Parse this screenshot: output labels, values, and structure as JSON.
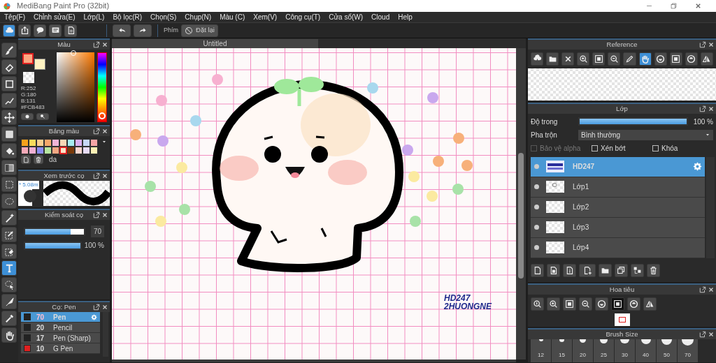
{
  "window": {
    "title": "MediBang Paint Pro (32bit)"
  },
  "menu": [
    "Tệp(F)",
    "Chỉnh sửa(E)",
    "Lớp(L)",
    "Bộ lọc(R)",
    "Chọn(S)",
    "Chụp(N)",
    "Màu (C)",
    "Xem(V)",
    "Công cụ(T)",
    "Cửa sổ(W)",
    "Cloud",
    "Help"
  ],
  "toolbar": {
    "icons": [
      {
        "kind": "cloud",
        "selected": true
      },
      {
        "kind": "share",
        "selected": false
      },
      {
        "kind": "chat",
        "selected": false
      },
      {
        "kind": "note",
        "selected": false
      },
      {
        "kind": "page",
        "selected": false
      }
    ],
    "key_label": "Phím",
    "reset": "Đặt lại"
  },
  "tools": [
    {
      "kind": "brush",
      "selected": false
    },
    {
      "kind": "eraser",
      "selected": false
    },
    {
      "kind": "square",
      "selected": false
    },
    {
      "kind": "polyline",
      "selected": false
    },
    {
      "kind": "move",
      "selected": false
    },
    {
      "kind": "filled-square",
      "selected": false
    },
    {
      "kind": "bucket",
      "selected": false
    },
    {
      "kind": "gradient",
      "selected": false
    },
    {
      "kind": "dashed-square",
      "selected": false
    },
    {
      "kind": "dashed-ellipse",
      "selected": false
    },
    {
      "kind": "wand",
      "selected": false
    },
    {
      "kind": "pencil-square",
      "selected": false
    },
    {
      "kind": "eraser-square",
      "selected": false
    },
    {
      "kind": "text",
      "selected": true
    },
    {
      "kind": "lasso",
      "selected": false
    },
    {
      "kind": "knife",
      "selected": false
    },
    {
      "kind": "eyedropper",
      "selected": false
    },
    {
      "kind": "hand",
      "selected": false
    }
  ],
  "color_panel": {
    "title": "Màu",
    "primary": {
      "color": "#fca882"
    },
    "secondary": {
      "color": "#fff3c2"
    },
    "hue": {
      "level": 0.03
    },
    "rgb": [
      "R:252",
      "G:180",
      "B:131"
    ],
    "hex": "#FCB483"
  },
  "palette": {
    "title": "Bảng màu",
    "name": "da",
    "swatches": [
      {
        "color": "#f7a21b",
        "selected": false
      },
      {
        "color": "#f9dc5c",
        "selected": false
      },
      {
        "color": "#f9cf8f",
        "selected": false
      },
      {
        "color": "#f4a86a",
        "selected": false
      },
      {
        "color": "#f2b4d6",
        "selected": false
      },
      {
        "color": "#fad7b6",
        "selected": false
      },
      {
        "color": "#a6ecef",
        "selected": false
      },
      {
        "color": "#d9b0ef",
        "selected": false
      },
      {
        "color": "#c6d8f7",
        "selected": false
      },
      {
        "color": "#f5a5a5",
        "selected": false
      },
      {
        "color": "#f4a9b8",
        "selected": false
      },
      {
        "color": "#f0b0d4",
        "selected": false
      },
      {
        "color": "#8a8cf0",
        "selected": false
      },
      {
        "color": "#b7e6a0",
        "selected": false
      },
      {
        "color": "#f3a783",
        "selected": false
      },
      {
        "color": "#fce4c7",
        "selected": true
      },
      {
        "color": "#7a3a0a",
        "selected": false
      },
      {
        "color": "#fcd7cf",
        "selected": false
      },
      {
        "color": "#e8dcf6",
        "selected": false
      },
      {
        "color": "#fdf0b4",
        "selected": false
      }
    ]
  },
  "brush_preview": {
    "title": "Xem trước cọ",
    "size": "* 5.08m"
  },
  "brush_control": {
    "title": "Kiểm soát cọ",
    "size": {
      "level": 0.78,
      "value": "70"
    },
    "opacity": {
      "level": 1,
      "reading": "100 %"
    }
  },
  "brushes": {
    "title": "Cọ: Pen",
    "items": [
      {
        "size": "70",
        "name": "Pen",
        "color": "#222222",
        "selected": true
      },
      {
        "size": "20",
        "name": "Pencil",
        "color": "#222222",
        "selected": false
      },
      {
        "size": "17",
        "name": "Pen (Sharp)",
        "color": "#222222",
        "selected": false
      },
      {
        "size": "10",
        "name": "G Pen",
        "color": "#e02020",
        "selected": false
      }
    ]
  },
  "canvas": {
    "tab": "Untitled",
    "signature": [
      "HD247",
      "2HUONGNE"
    ]
  },
  "reference": {
    "title": "Reference",
    "tools": [
      {
        "kind": "cloud-download",
        "selected": false
      },
      {
        "kind": "folder",
        "selected": false
      },
      {
        "kind": "close",
        "selected": false
      },
      {
        "kind": "zoom-in",
        "selected": false
      },
      {
        "kind": "fit",
        "selected": false
      },
      {
        "kind": "zoom-out",
        "selected": false
      },
      {
        "kind": "pen",
        "selected": false
      },
      {
        "kind": "hand",
        "selected": true
      },
      {
        "kind": "rotate-left",
        "selected": false
      },
      {
        "kind": "fit",
        "selected": false
      },
      {
        "kind": "rotate-right",
        "selected": false
      },
      {
        "kind": "flip",
        "selected": false
      }
    ]
  },
  "layers": {
    "title": "Lớp",
    "opacity": {
      "label": "Độ trong",
      "level": 1,
      "reading": "100 %"
    },
    "blend": {
      "label": "Pha trộn",
      "value": "Bình thường"
    },
    "options": [
      {
        "label": "Bảo vệ alpha",
        "checked": false,
        "disabled": true
      },
      {
        "label": "Xén bớt",
        "checked": false,
        "disabled": false
      },
      {
        "label": "Khóa",
        "checked": false,
        "disabled": false
      }
    ],
    "items": [
      {
        "name": "HD247",
        "kind": "logo",
        "selected": true
      },
      {
        "name": "Lớp1",
        "kind": "sketch",
        "selected": false
      },
      {
        "name": "Lớp2",
        "kind": "blank",
        "selected": false
      },
      {
        "name": "Lớp3",
        "kind": "blank",
        "selected": false
      },
      {
        "name": "Lớp4",
        "kind": "blank",
        "selected": false
      }
    ],
    "tools": [
      {
        "kind": "new-page"
      },
      {
        "kind": "page-copy"
      },
      {
        "kind": "page-info"
      },
      {
        "kind": "add-layer"
      },
      {
        "kind": "folder"
      },
      {
        "kind": "duplicate"
      },
      {
        "kind": "merge"
      },
      {
        "kind": "trash"
      }
    ]
  },
  "navigator": {
    "title": "Hoa tiêu",
    "tools": [
      {
        "kind": "zoom-actual",
        "selected": false
      },
      {
        "kind": "zoom-in",
        "selected": false
      },
      {
        "kind": "fit",
        "selected": false
      },
      {
        "kind": "zoom-out",
        "selected": false
      },
      {
        "kind": "rotate-left",
        "selected": false
      },
      {
        "kind": "fit",
        "selected": true
      },
      {
        "kind": "rotate-right",
        "selected": false
      },
      {
        "kind": "flip",
        "selected": false
      }
    ]
  },
  "brush_size": {
    "title": "Brush Size",
    "sizes": [
      "12",
      "15",
      "20",
      "25",
      "30",
      "40",
      "50",
      "70"
    ]
  }
}
